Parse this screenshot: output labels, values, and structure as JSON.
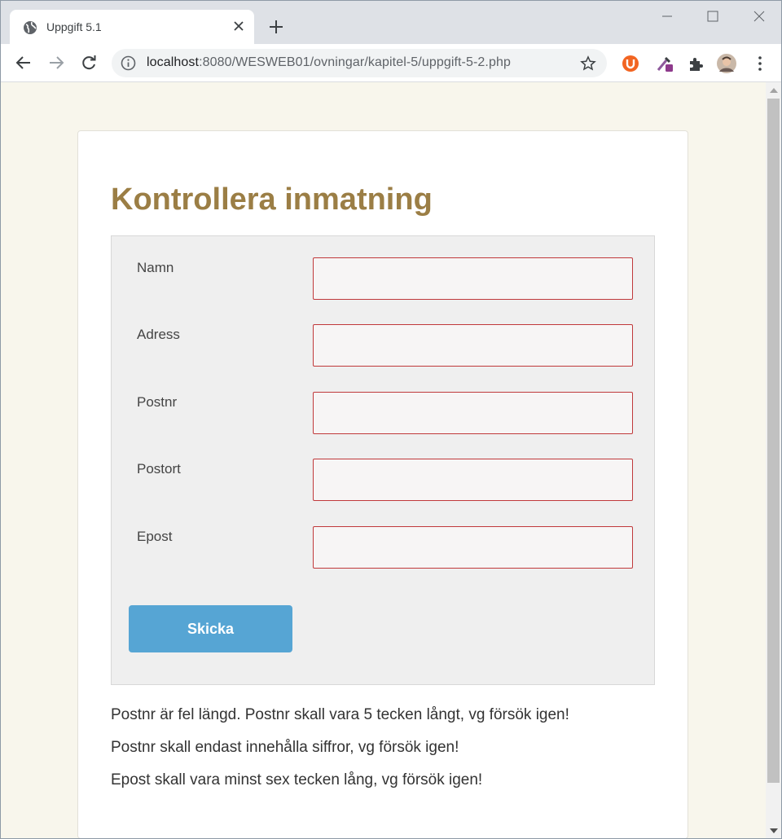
{
  "browser": {
    "tab_title": "Uppgift 5.1",
    "url_host": "localhost",
    "url_path": ":8080/WESWEB01/ovningar/kapitel-5/uppgift-5-2.php"
  },
  "page": {
    "heading": "Kontrollera inmatning",
    "fields": [
      {
        "label": "Namn",
        "value": ""
      },
      {
        "label": "Adress",
        "value": ""
      },
      {
        "label": "Postnr",
        "value": ""
      },
      {
        "label": "Postort",
        "value": ""
      },
      {
        "label": "Epost",
        "value": ""
      }
    ],
    "submit_label": "Skicka",
    "errors": [
      "Postnr är fel längd. Postnr skall vara 5 tecken långt, vg försök igen!",
      "Postnr skall endast innehålla siffror, vg försök igen!",
      "Epost skall vara minst sex tecken lång, vg försök igen!"
    ]
  },
  "colors": {
    "heading": "#9b7e45",
    "page_bg": "#f8f6ec",
    "button": "#56a5d4",
    "input_border_error": "#c0393b"
  }
}
